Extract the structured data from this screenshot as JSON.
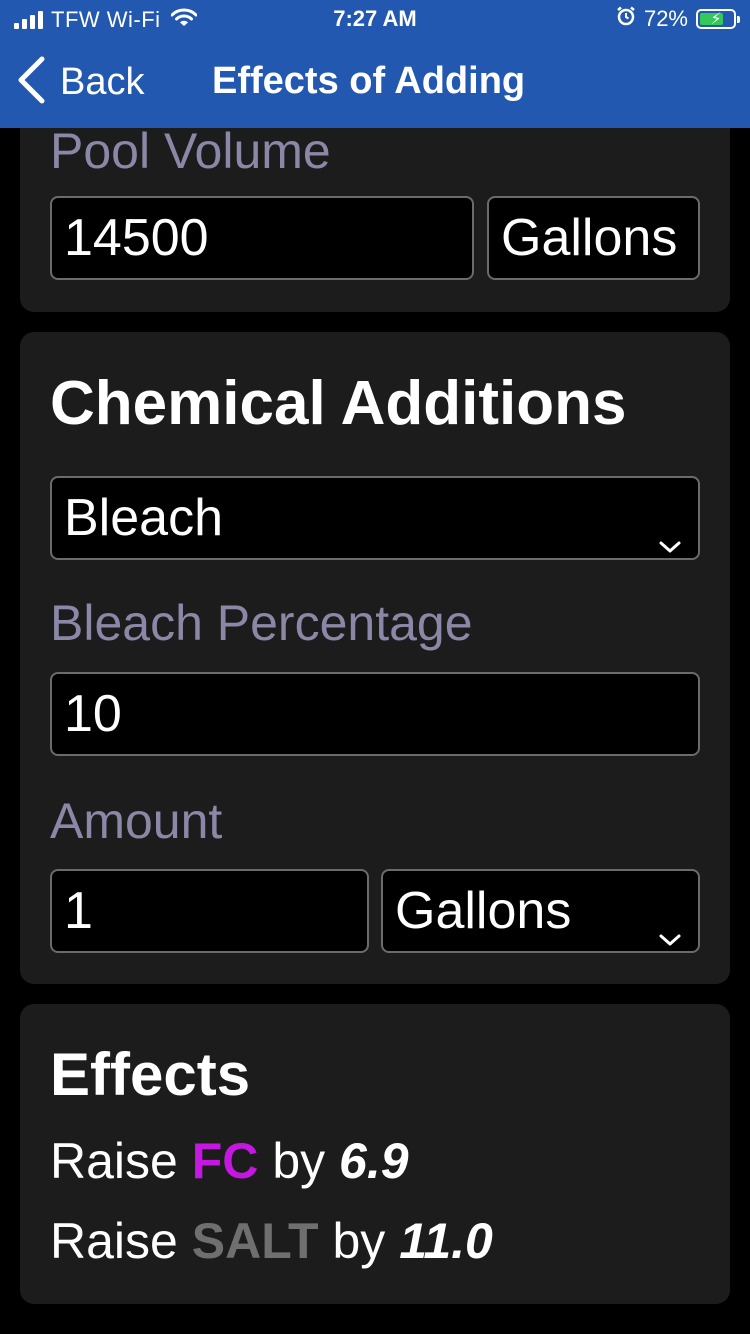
{
  "status_bar": {
    "carrier": "TFW Wi-Fi",
    "time": "7:27 AM",
    "battery_percent": "72%",
    "battery_level": 0.72
  },
  "nav": {
    "back_label": "Back",
    "title": "Effects of Adding"
  },
  "pool_volume": {
    "label": "Pool Volume",
    "value": "14500",
    "unit": "Gallons"
  },
  "chemical_additions": {
    "title": "Chemical Additions",
    "chemical": "Bleach",
    "percentage_label": "Bleach Percentage",
    "percentage_value": "10",
    "amount_label": "Amount",
    "amount_value": "1",
    "amount_unit": "Gallons"
  },
  "effects": {
    "title": "Effects",
    "lines": [
      {
        "prefix": "Raise",
        "chem": "FC",
        "by": "by",
        "value": "6.9",
        "color": "#c418e0"
      },
      {
        "prefix": "Raise",
        "chem": "SALT",
        "by": "by",
        "value": "11.0",
        "color": "#6f6f6f"
      }
    ]
  },
  "colors": {
    "header_bg": "#2358b0",
    "card_bg": "#1c1c1c",
    "muted_label": "#8b87a6",
    "battery_fill": "#35c759"
  }
}
